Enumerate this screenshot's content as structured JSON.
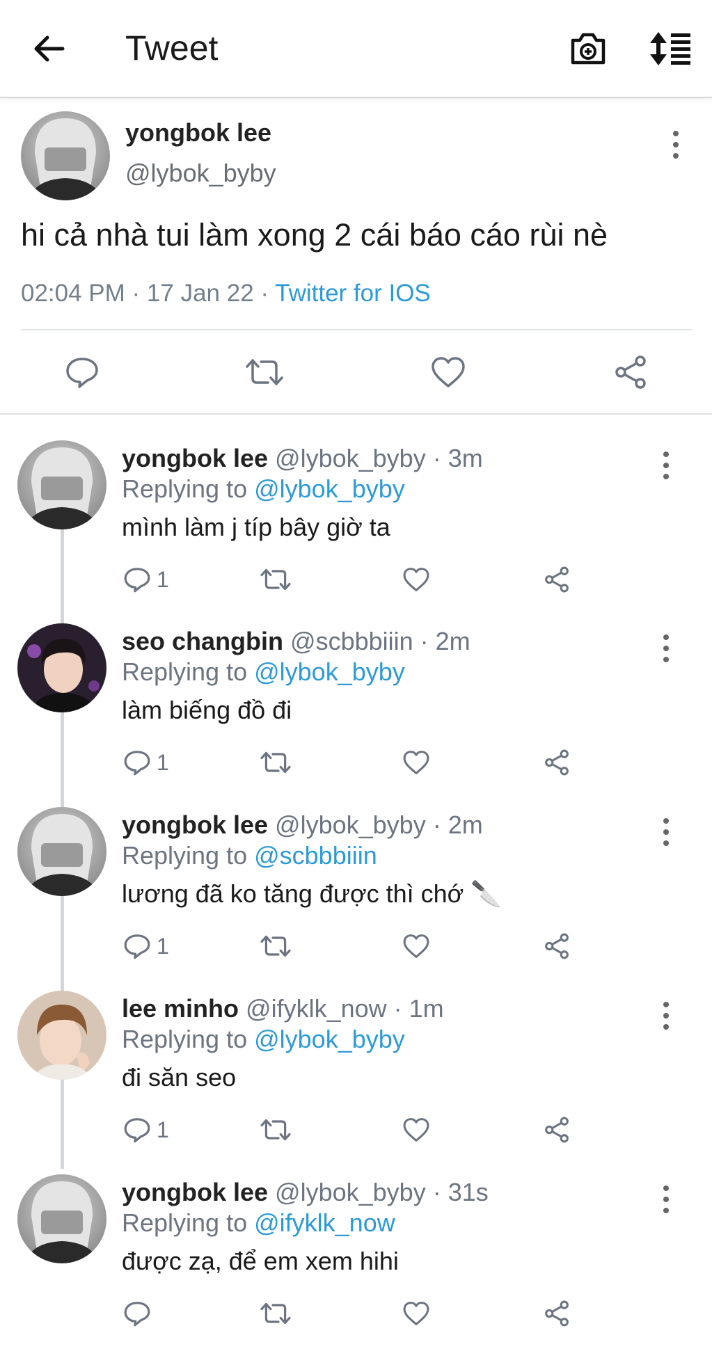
{
  "header": {
    "title": "Tweet",
    "icons": [
      "back-arrow-icon",
      "camera-icon",
      "sort-icon"
    ]
  },
  "main_tweet": {
    "name": "yongbok lee",
    "handle": "@lybok_byby",
    "text": "hi cả nhà tui làm xong 2 cái báo cáo rùi nè",
    "time": "02:04 PM · 17 Jan 22 · ",
    "source": "Twitter for IOS"
  },
  "replies": [
    {
      "name": "yongbok lee",
      "handle_time": " @lybok_byby · 3m",
      "replying_label": "Replying to ",
      "replying_to": "@lybok_byby",
      "text": "mình làm j típ bây giờ ta",
      "reply_count": "1",
      "avatar": "gray-hair"
    },
    {
      "name": "seo changbin",
      "handle_time": " @scbbbiiin · 2m",
      "replying_label": "Replying to ",
      "replying_to": "@lybok_byby",
      "text": "làm biếng đồ đi",
      "reply_count": "1",
      "avatar": "dark-hair"
    },
    {
      "name": "yongbok lee",
      "handle_time": " @lybok_byby · 2m",
      "replying_label": "Replying to ",
      "replying_to": "@scbbbiiin",
      "text": "lương đã ko tăng được thì chớ 🔪",
      "reply_count": "1",
      "avatar": "gray-hair"
    },
    {
      "name": "lee minho",
      "handle_time": " @ifyklk_now · 1m",
      "replying_label": "Replying to ",
      "replying_to": "@lybok_byby",
      "text": "đi săn seo",
      "reply_count": "1",
      "avatar": "brown-hair"
    },
    {
      "name": "yongbok lee",
      "handle_time": " @lybok_byby · 31s",
      "replying_label": "Replying to ",
      "replying_to": "@ifyklk_now",
      "text": "được zạ, để em xem hihi",
      "reply_count": "",
      "avatar": "gray-hair"
    }
  ],
  "colors": {
    "link": "#2d9ad8",
    "muted": "#6b7480",
    "text": "#1a1a1a"
  }
}
